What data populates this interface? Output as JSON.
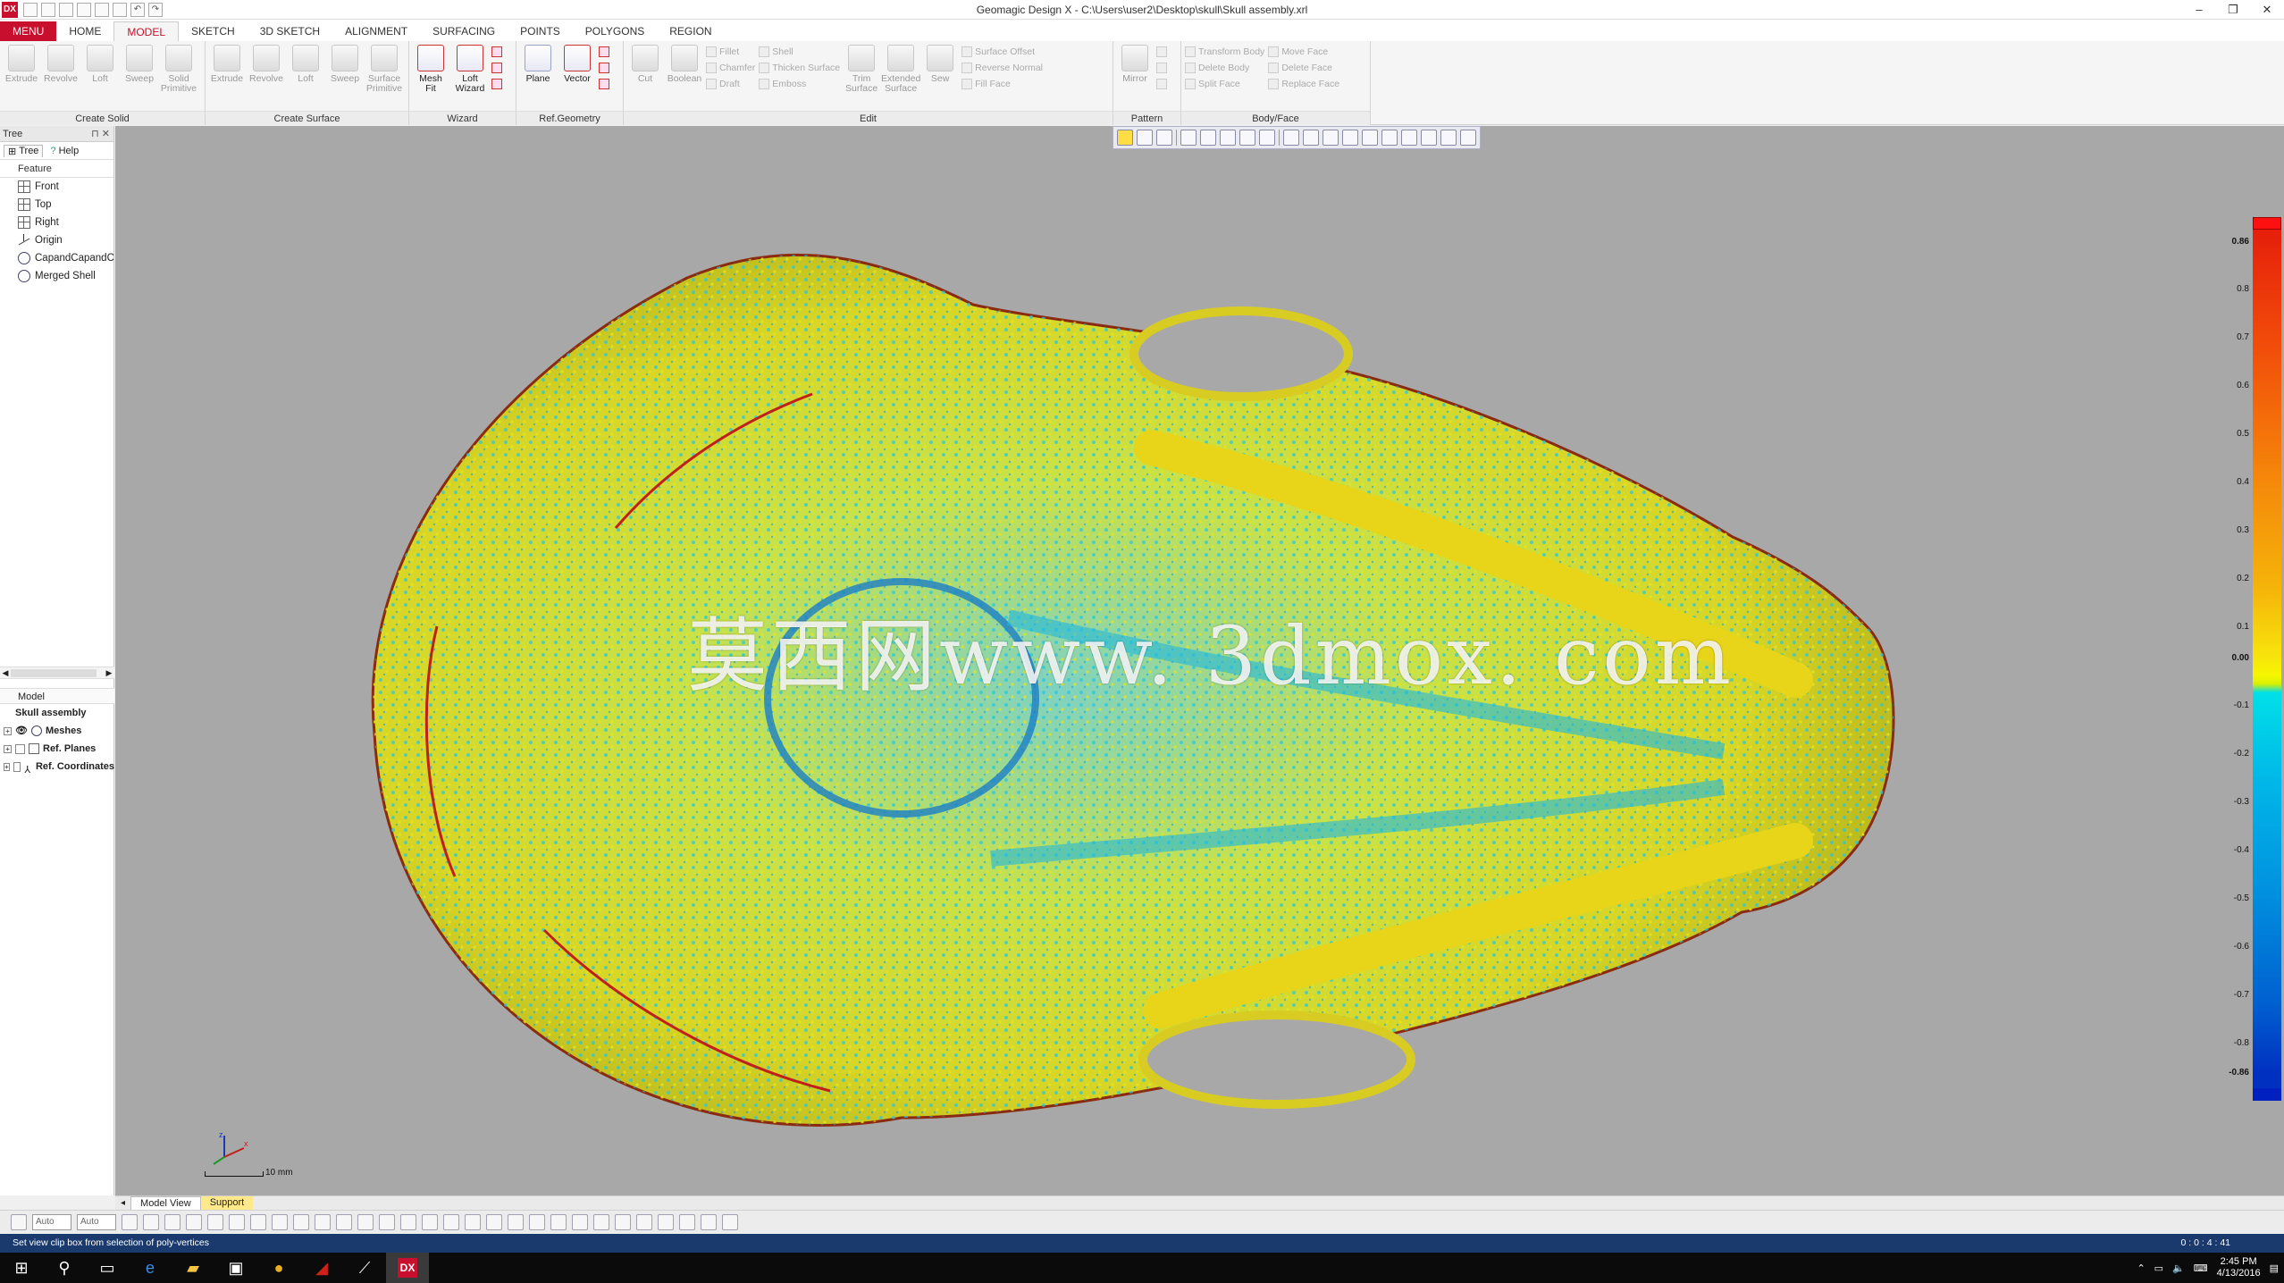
{
  "window": {
    "title": "Geomagic Design X - C:\\Users\\user2\\Desktop\\skull\\Skull assembly.xrl",
    "app_icon": "DX",
    "controls": {
      "minimize": "–",
      "restore": "❐",
      "close": "✕"
    }
  },
  "tabs": [
    "MENU",
    "HOME",
    "MODEL",
    "SKETCH",
    "3D SKETCH",
    "ALIGNMENT",
    "SURFACING",
    "POINTS",
    "POLYGONS",
    "REGION"
  ],
  "active_tab": "MODEL",
  "ribbon": {
    "create_solid": {
      "label": "Create Solid",
      "buttons": [
        "Extrude",
        "Revolve",
        "Loft",
        "Sweep",
        "Solid Primitive"
      ]
    },
    "create_surface": {
      "label": "Create Surface",
      "buttons": [
        "Extrude",
        "Revolve",
        "Loft",
        "Sweep",
        "Surface Primitive"
      ]
    },
    "wizard": {
      "label": "Wizard",
      "buttons": [
        "Mesh Fit",
        "Loft Wizard"
      ]
    },
    "ref_geometry": {
      "label": "Ref.Geometry",
      "buttons": [
        "Plane",
        "Vector"
      ]
    },
    "edit": {
      "label": "Edit",
      "buttons": [
        "Cut",
        "Boolean"
      ],
      "small": [
        "Fillet",
        "Chamfer",
        "Draft",
        "Shell",
        "Thicken Surface",
        "Emboss"
      ],
      "buttons2": [
        "Trim Surface",
        "Extended Surface",
        "Sew"
      ],
      "small2": [
        "Surface Offset",
        "Reverse Normal",
        "Fill Face"
      ]
    },
    "pattern": {
      "label": "Pattern",
      "buttons": [
        "Mirror"
      ]
    },
    "body_face": {
      "label": "Body/Face",
      "small": [
        "Transform Body",
        "Delete Body",
        "Split Face",
        "Move Face",
        "Delete Face",
        "Replace Face"
      ]
    }
  },
  "tree_panel": {
    "title": "Tree",
    "tabs": [
      "Tree",
      "Help"
    ],
    "column": "Feature",
    "items": [
      "Front",
      "Top",
      "Right",
      "Origin",
      "CapandCapandCapandCapa",
      "Merged Shell"
    ]
  },
  "model_panel": {
    "title": "Model",
    "root": "Skull assembly",
    "items": [
      "Meshes",
      "Ref. Planes",
      "Ref. Coordinates"
    ]
  },
  "watermark": "莫西网www. 3dmox. com",
  "color_scale": {
    "max_label": "0.86",
    "min_label": "-0.86",
    "ticks": [
      "0.86",
      "0.8",
      "0.7",
      "0.6",
      "0.5",
      "0.4",
      "0.3",
      "0.2",
      "0.1",
      "0.00",
      "-0.1",
      "-0.2",
      "-0.3",
      "-0.4",
      "-0.5",
      "-0.6",
      "-0.7",
      "-0.8",
      "-0.86"
    ]
  },
  "scale_bar": "10 mm",
  "view_tabs": [
    "Model View",
    "Support"
  ],
  "bottom_toolbar": {
    "combo1": "Auto",
    "combo2": "Auto"
  },
  "status_text": "Set view clip box from selection of poly-vertices",
  "status_coords": "0 : 0 : 4 : 41",
  "taskbar": {
    "time": "2:45 PM",
    "date": "4/13/2016"
  }
}
